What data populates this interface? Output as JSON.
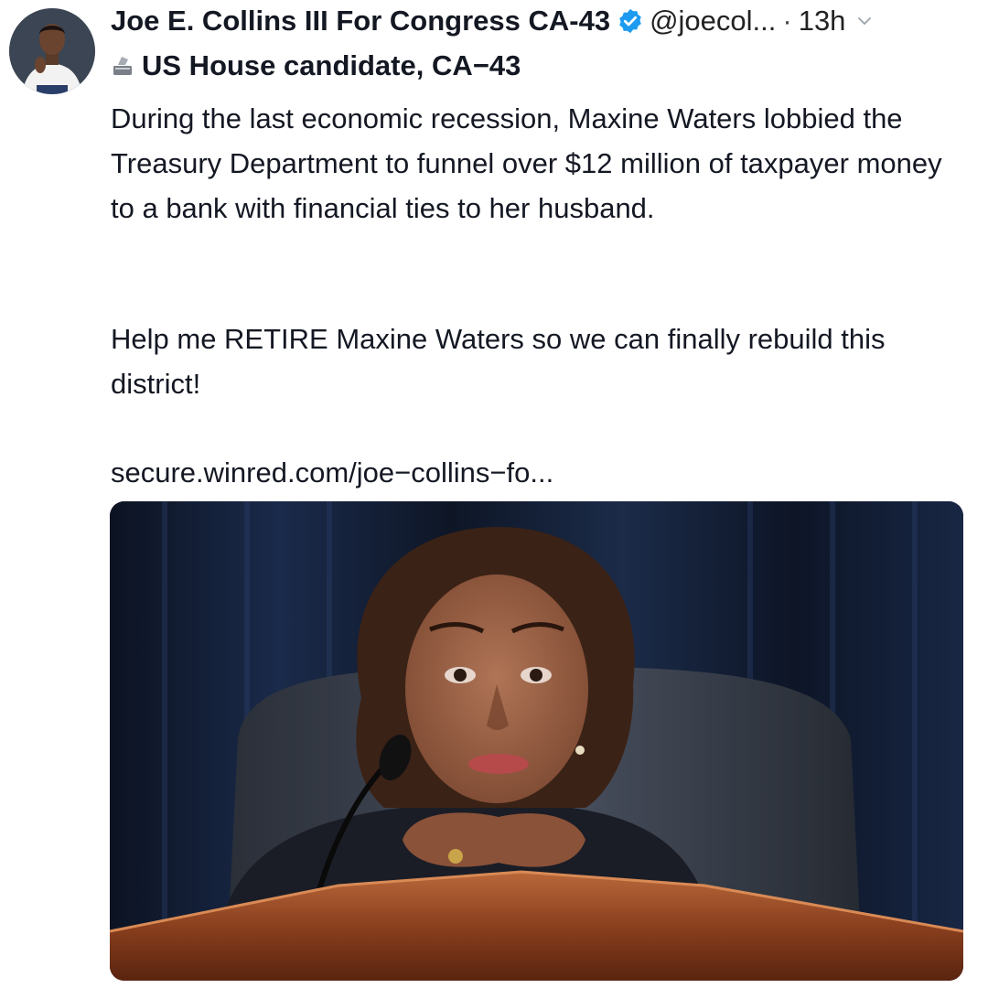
{
  "tweet": {
    "author_name": "Joe E. Collins III For Congress CA-43",
    "handle": "@joecol...",
    "separator": "·",
    "time": "13h",
    "bio_label": "US House candidate, CA−43",
    "paragraphs": [
      "During the last economic recession, Maxine Waters lobbied the Treasury Department to funnel over $12 million of taxpayer money to a bank with financial ties to her husband.",
      "Help me RETIRE Maxine Waters so we can finally rebuild this district!"
    ],
    "link": "secure.winred.com/joe−collins−fo..."
  },
  "icons": {
    "verified": "verified-badge-icon",
    "menu": "chevron-down-icon",
    "ballot": "ballot-box-icon"
  },
  "colors": {
    "verified_blue": "#1d9bf0",
    "text": "#141823",
    "background": "#ffffff"
  }
}
